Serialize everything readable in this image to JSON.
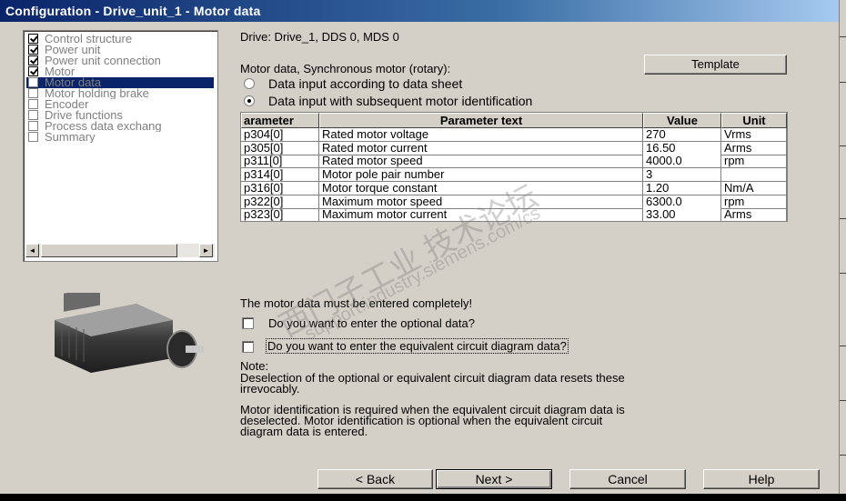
{
  "window": {
    "title": "Configuration - Drive_unit_1 - Motor data"
  },
  "tree": {
    "items": [
      {
        "label": "Control structure",
        "checked": true
      },
      {
        "label": "Power unit",
        "checked": true
      },
      {
        "label": "Power unit connection",
        "checked": true
      },
      {
        "label": "Motor",
        "checked": true
      },
      {
        "label": "Motor data",
        "checked": false,
        "selected": true
      },
      {
        "label": "Motor holding brake",
        "checked": false
      },
      {
        "label": "Encoder",
        "checked": false
      },
      {
        "label": "Drive functions",
        "checked": false
      },
      {
        "label": "Process data exchang",
        "checked": false
      },
      {
        "label": "Summary",
        "checked": false
      }
    ],
    "scroll_left_glyph": "◄",
    "scroll_right_glyph": "►"
  },
  "drive_info": "Drive: Drive_1, DDS 0, MDS 0",
  "motor_type_label": "Motor data, Synchronous motor (rotary):",
  "template_button": "Template",
  "radio": {
    "option1": "Data input according to data sheet",
    "option2": "Data input with subsequent motor identification",
    "selected": 2
  },
  "table": {
    "headers": [
      "arameter",
      "Parameter text",
      "Value",
      "Unit"
    ],
    "rows": [
      {
        "param": "p304[0]",
        "text": "Rated motor voltage",
        "value": "270",
        "unit": "Vrms"
      },
      {
        "param": "p305[0]",
        "text": "Rated motor current",
        "value": "16.50",
        "unit": "Arms"
      },
      {
        "param": "p311[0]",
        "text": "Rated motor speed",
        "value": "4000.0",
        "unit": "rpm"
      },
      {
        "param": "p314[0]",
        "text": "Motor pole pair number",
        "value": "3",
        "unit": ""
      },
      {
        "param": "p316[0]",
        "text": "Motor torque constant",
        "value": "1.20",
        "unit": "Nm/A"
      },
      {
        "param": "p322[0]",
        "text": "Maximum motor speed",
        "value": "6300.0",
        "unit": "rpm"
      },
      {
        "param": "p323[0]",
        "text": "Maximum motor current",
        "value": "33.00",
        "unit": "Arms"
      }
    ]
  },
  "messages": {
    "must_complete": "The motor data must be entered completely!",
    "optional_q": "Do you want to enter the optional data?",
    "equivalent_q": "Do you want to enter the equivalent circuit diagram data?",
    "note_title": "Note:",
    "note_line1": "Deselection of the optional or equivalent circuit diagram data resets these",
    "note_line2": "irrevocably.",
    "ident_line1": "Motor identification is required when the equivalent circuit diagram data is",
    "ident_line2": "deselected. Motor identification is optional when the equivalent circuit",
    "ident_line3": "diagram data is entered."
  },
  "buttons": {
    "back": "< Back",
    "next": "Next >",
    "cancel": "Cancel",
    "help": "Help"
  },
  "watermark": {
    "line1": "西门子工业  技术论坛",
    "line2": "support.industry.siemens.com/cs"
  },
  "icons": {
    "motor_image": "servo-motor-illustration"
  }
}
